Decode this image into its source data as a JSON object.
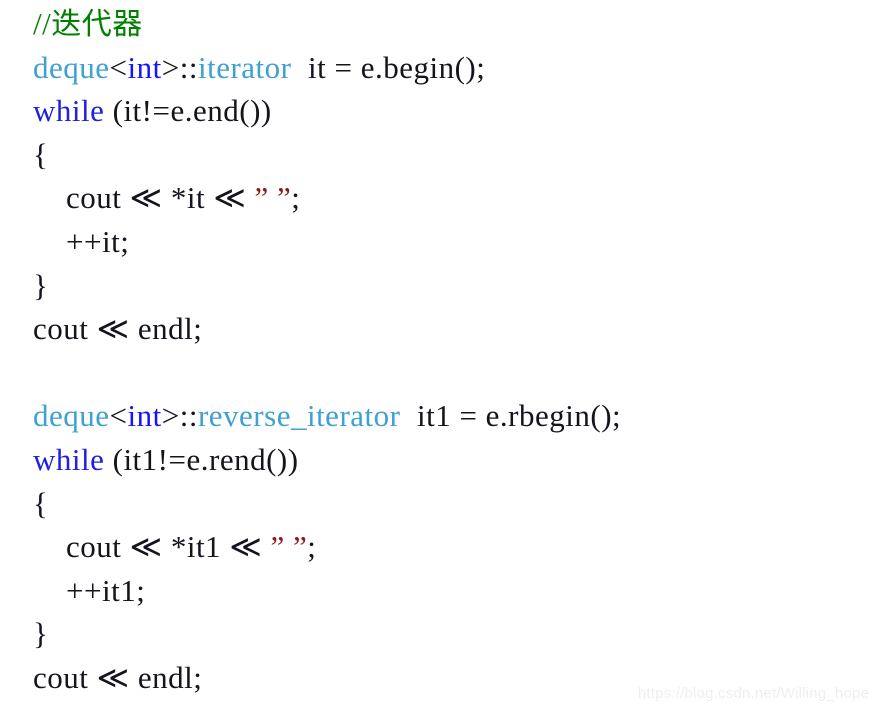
{
  "document": {
    "kind": "code-screenshot",
    "language": "C++",
    "background_color": "#ffffff",
    "default_text_color": "#14141e"
  },
  "palette": {
    "comment_green": "#008000",
    "type_blue": "#3fa0d2",
    "keyword_blue": "#2020e0",
    "builtin_blue": "#1414ff",
    "string_red": "#8b1a1a",
    "plain_black": "#14141e",
    "watermark_gray": "#eceff1"
  },
  "code": {
    "lines": [
      {
        "index": 1,
        "indent": 0,
        "text": "//迭代器",
        "tokens": [
          {
            "t": "//",
            "c": "comment"
          },
          {
            "t": "迭代器",
            "c": "comment-cjk"
          }
        ]
      },
      {
        "index": 2,
        "indent": 0,
        "text": "deque<int>::iterator  it = e.begin();",
        "tokens": [
          {
            "t": "deque",
            "c": "type"
          },
          {
            "t": "<",
            "c": "plain"
          },
          {
            "t": "int",
            "c": "builtin"
          },
          {
            "t": ">",
            "c": "plain"
          },
          {
            "t": "::",
            "c": "plain"
          },
          {
            "t": "iterator",
            "c": "type"
          },
          {
            "t": "  it = e.begin();",
            "c": "plain"
          }
        ]
      },
      {
        "index": 3,
        "indent": 0,
        "text": "while (it!=e.end())",
        "tokens": [
          {
            "t": "while",
            "c": "keyword"
          },
          {
            "t": " (it!=e.end())",
            "c": "plain"
          }
        ]
      },
      {
        "index": 4,
        "indent": 0,
        "text": "{",
        "tokens": [
          {
            "t": "{",
            "c": "plain"
          }
        ]
      },
      {
        "index": 5,
        "indent": 4,
        "text": "cout << *it << ” ”;",
        "tokens": [
          {
            "t": "cout ",
            "c": "plain"
          },
          {
            "t": "≪",
            "c": "plain"
          },
          {
            "t": " *it ",
            "c": "plain"
          },
          {
            "t": "≪",
            "c": "plain"
          },
          {
            "t": " ” ”",
            "c": "string"
          },
          {
            "t": ";",
            "c": "plain"
          }
        ]
      },
      {
        "index": 6,
        "indent": 4,
        "text": "++it;",
        "tokens": [
          {
            "t": "++it;",
            "c": "plain"
          }
        ]
      },
      {
        "index": 7,
        "indent": 0,
        "text": "}",
        "tokens": [
          {
            "t": "}",
            "c": "plain"
          }
        ]
      },
      {
        "index": 8,
        "indent": 0,
        "text": "cout << endl;",
        "tokens": [
          {
            "t": "cout ",
            "c": "plain"
          },
          {
            "t": "≪",
            "c": "plain"
          },
          {
            "t": " endl;",
            "c": "plain"
          }
        ]
      },
      {
        "index": 9,
        "indent": 0,
        "text": "",
        "tokens": []
      },
      {
        "index": 10,
        "indent": 0,
        "text": "deque<int>::reverse_iterator  it1 = e.rbegin();",
        "tokens": [
          {
            "t": "deque",
            "c": "type"
          },
          {
            "t": "<",
            "c": "plain"
          },
          {
            "t": "int",
            "c": "builtin"
          },
          {
            "t": ">",
            "c": "plain"
          },
          {
            "t": "::",
            "c": "plain"
          },
          {
            "t": "reverse_iterator",
            "c": "type"
          },
          {
            "t": "  it1 = e.rbegin();",
            "c": "plain"
          }
        ]
      },
      {
        "index": 11,
        "indent": 0,
        "text": "while (it1!=e.rend())",
        "tokens": [
          {
            "t": "while",
            "c": "keyword"
          },
          {
            "t": " (it1!=e.rend())",
            "c": "plain"
          }
        ]
      },
      {
        "index": 12,
        "indent": 0,
        "text": "{",
        "tokens": [
          {
            "t": "{",
            "c": "plain"
          }
        ]
      },
      {
        "index": 13,
        "indent": 4,
        "text": "cout << *it1 << ” ”;",
        "tokens": [
          {
            "t": "cout ",
            "c": "plain"
          },
          {
            "t": "≪",
            "c": "plain"
          },
          {
            "t": " *it1 ",
            "c": "plain"
          },
          {
            "t": "≪",
            "c": "plain"
          },
          {
            "t": " ” ”",
            "c": "string"
          },
          {
            "t": ";",
            "c": "plain"
          }
        ]
      },
      {
        "index": 14,
        "indent": 4,
        "text": "++it1;",
        "tokens": [
          {
            "t": "++it1;",
            "c": "plain"
          }
        ]
      },
      {
        "index": 15,
        "indent": 0,
        "text": "}",
        "tokens": [
          {
            "t": "}",
            "c": "plain"
          }
        ]
      },
      {
        "index": 16,
        "indent": 0,
        "text": "cout << endl;",
        "tokens": [
          {
            "t": "cout ",
            "c": "plain"
          },
          {
            "t": "≪",
            "c": "plain"
          },
          {
            "t": " endl;",
            "c": "plain"
          }
        ]
      }
    ]
  },
  "watermark": {
    "text": "https://blog.csdn.net/Willing_hope"
  }
}
